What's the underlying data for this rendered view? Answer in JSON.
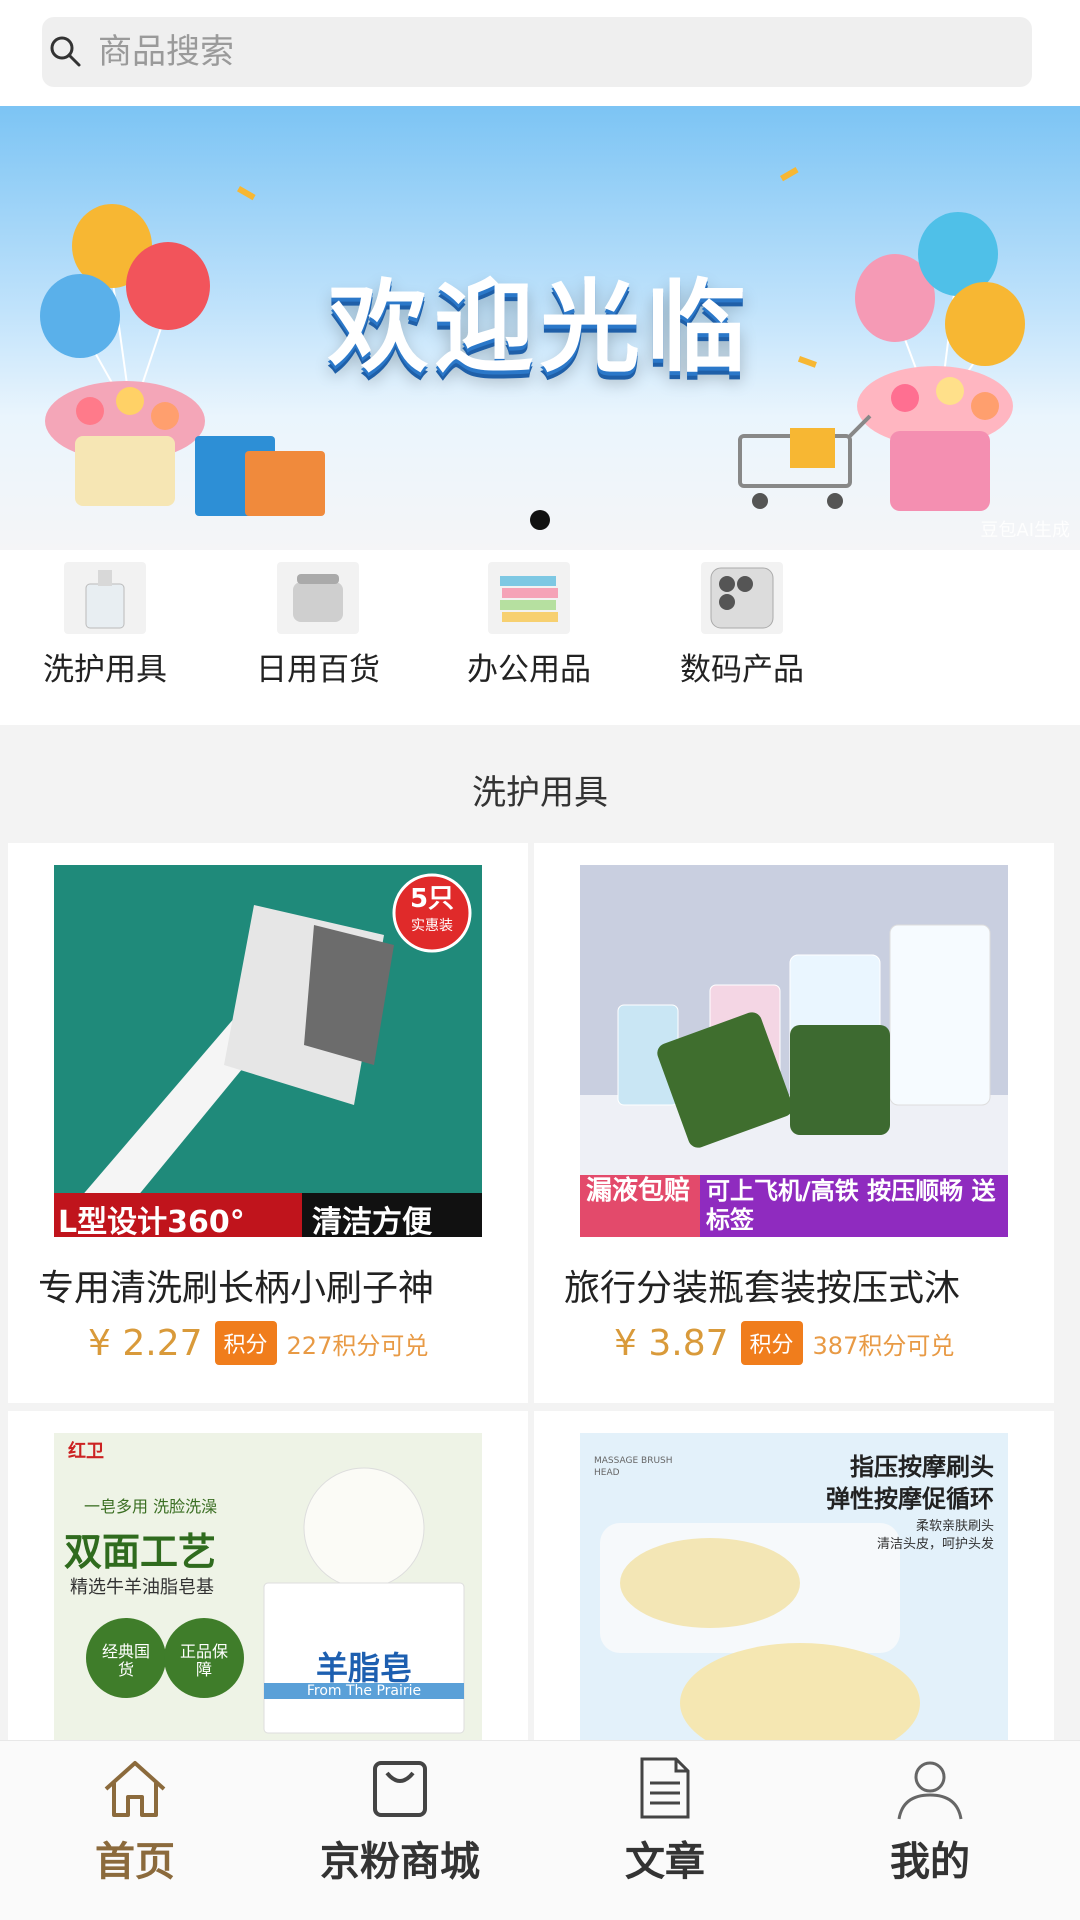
{
  "search": {
    "placeholder": "商品搜索"
  },
  "banner": {
    "title": "欢迎光临",
    "watermark": "豆包AI生成"
  },
  "categories": [
    {
      "label": "洗护用具"
    },
    {
      "label": "日用百货"
    },
    {
      "label": "办公用品"
    },
    {
      "label": "数码产品"
    }
  ],
  "section": {
    "title": "洗护用具"
  },
  "products": [
    {
      "name": "专用清洗刷长柄小刷子神",
      "price": "¥ 2.27",
      "badge": "积分",
      "points": "227积分可兑",
      "tag": "5只",
      "tag_sub": "实惠装",
      "caption_left": "L型设计360°",
      "caption_right": "清洁方便"
    },
    {
      "name": "旅行分装瓶套装按压式沐",
      "price": "¥ 3.87",
      "badge": "积分",
      "points": "387积分可兑",
      "caption_left": "漏液包赔",
      "caption_right": "可上飞机/高铁 按压顺畅 送标签"
    },
    {
      "name": "",
      "image_text": {
        "brand": "红卫",
        "line1": "一皂多用 洗脸洗澡",
        "line2": "双面工艺",
        "line3": "精选牛羊油脂皂基",
        "seal1": "经典国货",
        "seal2": "正品保障",
        "box_title": "羊脂皂",
        "box_en": "From The Prairie"
      }
    },
    {
      "name": "",
      "image_text": {
        "small_en": "MASSAGE BRUSH HEAD",
        "line1": "指压按摩刷头",
        "line2": "弹性按摩促循环",
        "line3": "柔软亲肤刷头",
        "line4": "清洁头皮，呵护头发"
      }
    }
  ],
  "tabbar": [
    {
      "label": "首页",
      "icon": "home-icon",
      "active": true
    },
    {
      "label": "京粉商城",
      "icon": "bag-icon",
      "active": false
    },
    {
      "label": "文章",
      "icon": "document-icon",
      "active": false
    },
    {
      "label": "我的",
      "icon": "user-icon",
      "active": false
    }
  ],
  "colors": {
    "accent": "#8b6a3c",
    "price": "#d99a3a",
    "badge": "#f07d1c"
  }
}
